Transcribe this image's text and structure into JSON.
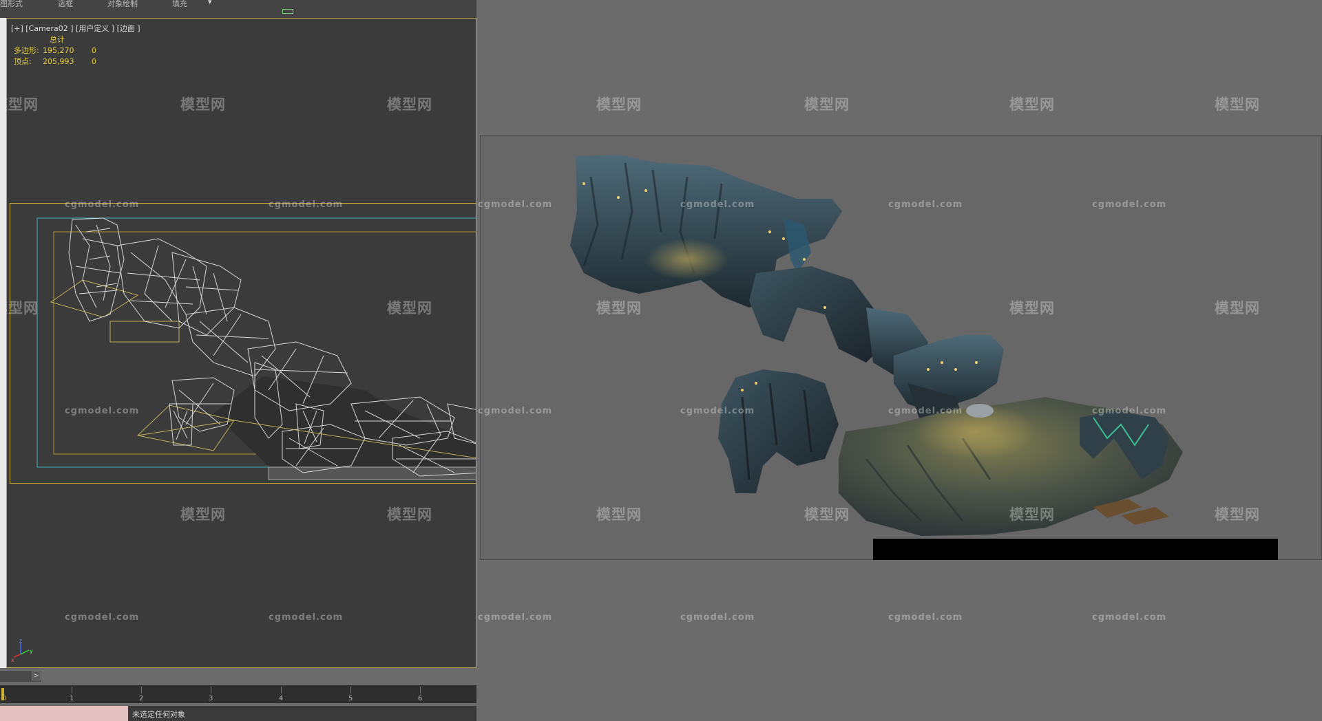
{
  "toolbar": {
    "labels": [
      "图形式",
      "选框",
      "对象绘制",
      "填充"
    ],
    "glyph": "▾"
  },
  "viewport": {
    "label": "[+] [Camera02 ] [用户定义 ] [边面 ]",
    "stats_header": "总计",
    "stats": [
      {
        "label": "多边形:",
        "value": "195,270",
        "selected": "0"
      },
      {
        "label": "顶点:",
        "value": "205,993",
        "selected": "0"
      }
    ]
  },
  "timeline": {
    "ticks": [
      "0",
      "1",
      "2",
      "3",
      "4",
      "5",
      "6"
    ],
    "nav_arrow": ">"
  },
  "status": {
    "message": "未选定任何对象"
  },
  "watermark": {
    "logo_text": "模型网",
    "url_text": "cgmodel.com"
  },
  "colors": {
    "viewport_bg": "#3b3b3b",
    "render_bg": "#6b6b6b",
    "stats_text": "#e8cf3a",
    "safe_frame": "#c8aa3a",
    "camera_frame": "#46b4c4"
  }
}
